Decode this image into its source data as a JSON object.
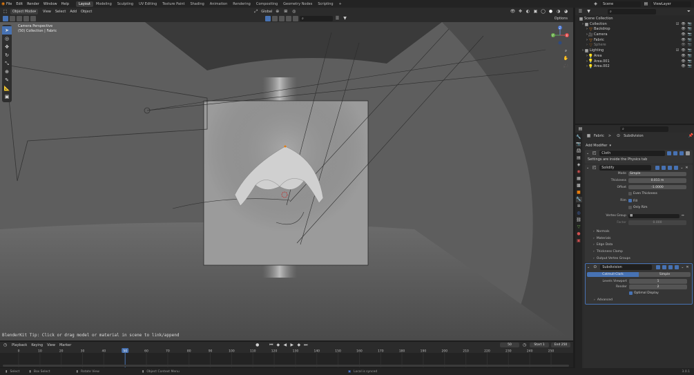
{
  "topbar": {
    "menus": [
      "File",
      "Edit",
      "Render",
      "Window",
      "Help"
    ],
    "workspaces": [
      "Layout",
      "Modeling",
      "Sculpting",
      "UV Editing",
      "Texture Paint",
      "Shading",
      "Animation",
      "Rendering",
      "Compositing",
      "Geometry Nodes",
      "Scripting"
    ],
    "add_tab": "+",
    "scene": "Scene",
    "view_layer": "ViewLayer"
  },
  "viewport_header": {
    "mode": "Object Mode",
    "menus": [
      "View",
      "Select",
      "Add",
      "Object"
    ],
    "orientation": "Global",
    "options": "Options"
  },
  "viewport": {
    "camera_title": "Camera Perspective",
    "camera_sub": "(50) Collection | Fabric",
    "tip": "BlenderKit Tip: Click or drag model or material in scene to link/append",
    "gizmo_axes": {
      "x": "X",
      "y": "Y",
      "z": "Z"
    }
  },
  "outliner": {
    "root": "Scene Collection",
    "items": [
      {
        "name": "Collection",
        "level": 1
      },
      {
        "name": "Backdrop",
        "level": 2
      },
      {
        "name": "Camera",
        "level": 2
      },
      {
        "name": "Fabric",
        "level": 2
      },
      {
        "name": "Sphere",
        "level": 2
      },
      {
        "name": "Lighting",
        "level": 1
      },
      {
        "name": "Area",
        "level": 2
      },
      {
        "name": "Area.001",
        "level": 2
      },
      {
        "name": "Area.002",
        "level": 2
      }
    ]
  },
  "properties": {
    "breadcrumb_object": "Fabric",
    "breadcrumb_sep": ">",
    "breadcrumb_modifier": "Subdivision",
    "add_modifier": "Add Modifier",
    "cloth": {
      "name": "Cloth",
      "note": "Settings are inside the Physics tab"
    },
    "solidify": {
      "name": "Solidify",
      "mode_label": "Mode",
      "mode": "Simple",
      "thickness_label": "Thickness",
      "thickness": "0.011 m",
      "offset_label": "Offset",
      "offset": "-1.0000",
      "even_thickness": "Even Thickness",
      "rim_label": "Rim",
      "fill": "Fill",
      "only_rim": "Only Rim",
      "vgroup_label": "Vertex Group",
      "factor_label": "Factor",
      "factor": "0.000",
      "subpanels": [
        "Normals",
        "Materials",
        "Edge Data",
        "Thickness Clamp",
        "Output Vertex Groups"
      ]
    },
    "subdivision": {
      "name": "Subdivision",
      "catmull": "Catmull-Clark",
      "simple": "Simple",
      "levels_label": "Levels Viewport",
      "levels": "1",
      "render_label": "Render",
      "render": "2",
      "optimal": "Optimal Display",
      "advanced": "Advanced"
    }
  },
  "timeline": {
    "menus": [
      "Playback",
      "Keying",
      "View",
      "Marker"
    ],
    "current": "50",
    "start_label": "Start",
    "start": "1",
    "end_label": "End",
    "end": "250",
    "ticks": [
      0,
      10,
      20,
      30,
      40,
      50,
      60,
      70,
      80,
      90,
      100,
      110,
      120,
      130,
      140,
      150,
      160,
      170,
      180,
      190,
      200,
      210,
      220,
      230,
      240,
      250
    ],
    "current_frame": 50,
    "range_max": 250
  },
  "statusbar": {
    "select": "Select",
    "box_select": "Box Select",
    "rotate": "Rotate View",
    "context": "Object Context Menu",
    "local": "Local is synced",
    "version": "3.0.1"
  }
}
